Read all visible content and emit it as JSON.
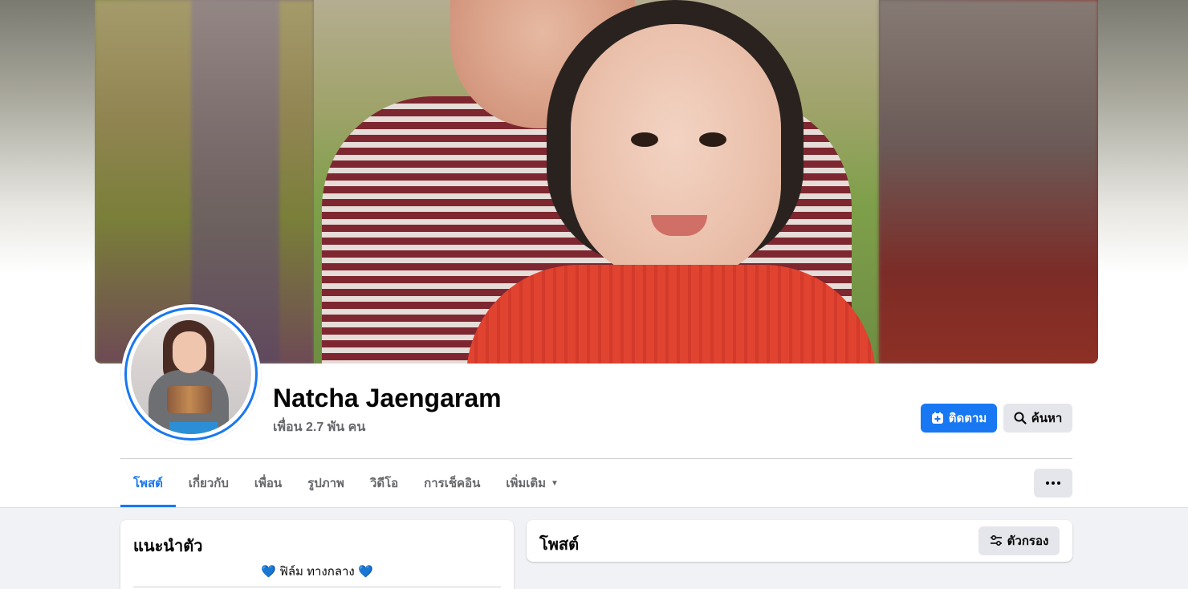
{
  "profile": {
    "name": "Natcha Jaengaram",
    "friends": "เพื่อน 2.7 พัน คน"
  },
  "actions": {
    "follow_label": "ติดตาม",
    "search_label": "ค้นหา",
    "follow_icon": "plus-square-icon",
    "search_icon": "search-icon",
    "more_icon": "more-dots-icon"
  },
  "tabs": [
    {
      "label": "โพสต์",
      "active": true
    },
    {
      "label": "เกี่ยวกับ"
    },
    {
      "label": "เพื่อน"
    },
    {
      "label": "รูปภาพ"
    },
    {
      "label": "วิดีโอ"
    },
    {
      "label": "การเช็คอิน"
    },
    {
      "label": "เพิ่มเติม",
      "caret": "▼"
    }
  ],
  "intro": {
    "title": "แนะนำตัว",
    "bio_text": "ฟิล์ม ทางกลาง",
    "bio_heart": "💙"
  },
  "posts": {
    "title": "โพสต์",
    "filter_label": "ตัวกรอง",
    "filter_icon": "filter-sliders-icon"
  },
  "colors": {
    "accent": "#1877f2",
    "secondary_text": "#65676b",
    "button_gray": "#e4e6eb",
    "page_bg": "#f0f2f5"
  }
}
